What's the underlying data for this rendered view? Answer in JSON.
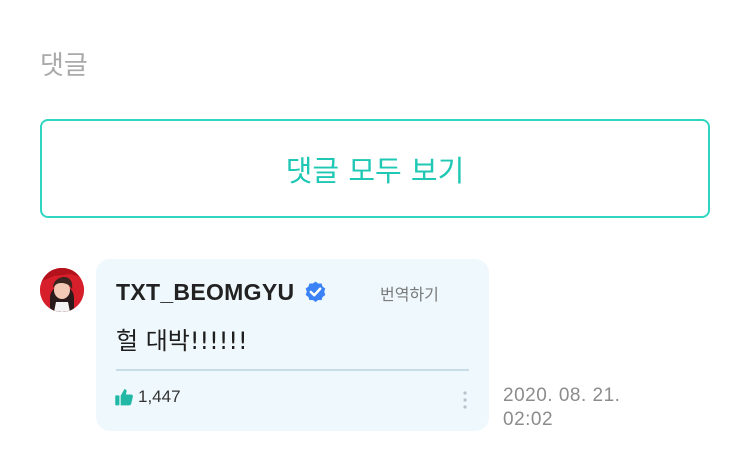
{
  "section": {
    "title": "댓글"
  },
  "view_all_button": {
    "label": "댓글 모두 보기"
  },
  "comment": {
    "author": "TXT_BEOMGYU",
    "verified": true,
    "translate_label": "번역하기",
    "text": "헐 대박!!!!!!",
    "likes": "1,447",
    "date": "2020. 08. 21.",
    "time": "02:02"
  },
  "colors": {
    "accent": "#1fc8b4",
    "bubble_bg": "#eef8fd",
    "verified": "#3b82f6",
    "like_icon": "#22b8a6"
  }
}
